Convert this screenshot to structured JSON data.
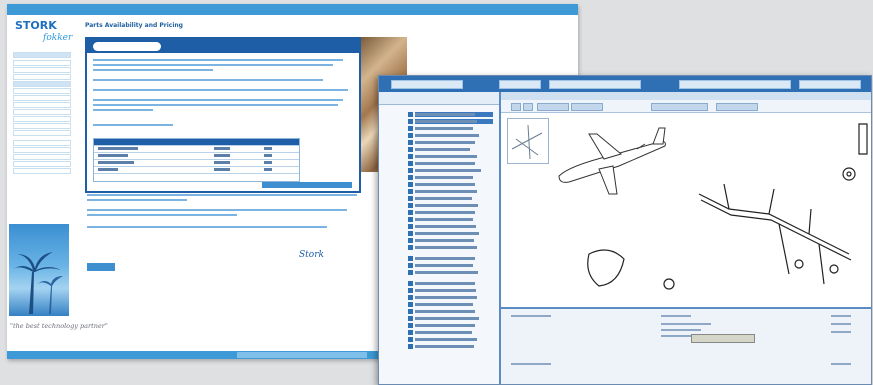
{
  "screen1": {
    "top_nav": [
      "",
      "",
      "",
      "",
      ""
    ],
    "logo_text": "STORK",
    "logo_sub": "fokker",
    "sidebar_heading": "",
    "sidebar_items": [
      "",
      "",
      "",
      "",
      "",
      "",
      "",
      "",
      "",
      "",
      "",
      "",
      "",
      "",
      "",
      "",
      ""
    ],
    "selected_sidebar_index": 0,
    "page_title": "Parts Availability and Pricing",
    "tagline": "\"the best technology partner\"",
    "signature": "Stork",
    "footer": ""
  },
  "screen2": {
    "tree_title": "",
    "drawing_title": "",
    "toolbar_labels": [
      "",
      "",
      "",
      "",
      ""
    ],
    "drawing_caption": ""
  },
  "colors": {
    "brand_blue": "#3d9ad6",
    "panel_blue": "#1d5ea7",
    "app_blue": "#2f6fb3"
  }
}
